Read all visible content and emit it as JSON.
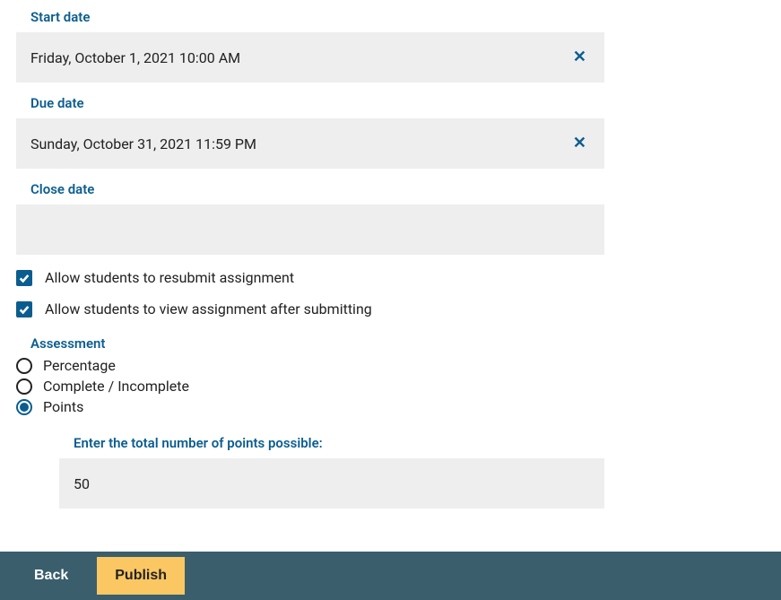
{
  "startDate": {
    "label": "Start date",
    "value": "Friday, October 1, 2021 10:00 AM"
  },
  "dueDate": {
    "label": "Due date",
    "value": "Sunday, October 31, 2021 11:59 PM"
  },
  "closeDate": {
    "label": "Close date",
    "value": ""
  },
  "options": {
    "resubmitLabel": "Allow students to resubmit assignment",
    "resubmitChecked": true,
    "viewAfterLabel": "Allow students to view assignment after submitting",
    "viewAfterChecked": true
  },
  "assessment": {
    "title": "Assessment",
    "percentageLabel": "Percentage",
    "completeLabel": "Complete / Incomplete",
    "pointsLabel": "Points",
    "selected": "points",
    "pointsPrompt": "Enter the total number of points possible:",
    "pointsValue": "50"
  },
  "footer": {
    "backLabel": "Back",
    "publishLabel": "Publish"
  }
}
